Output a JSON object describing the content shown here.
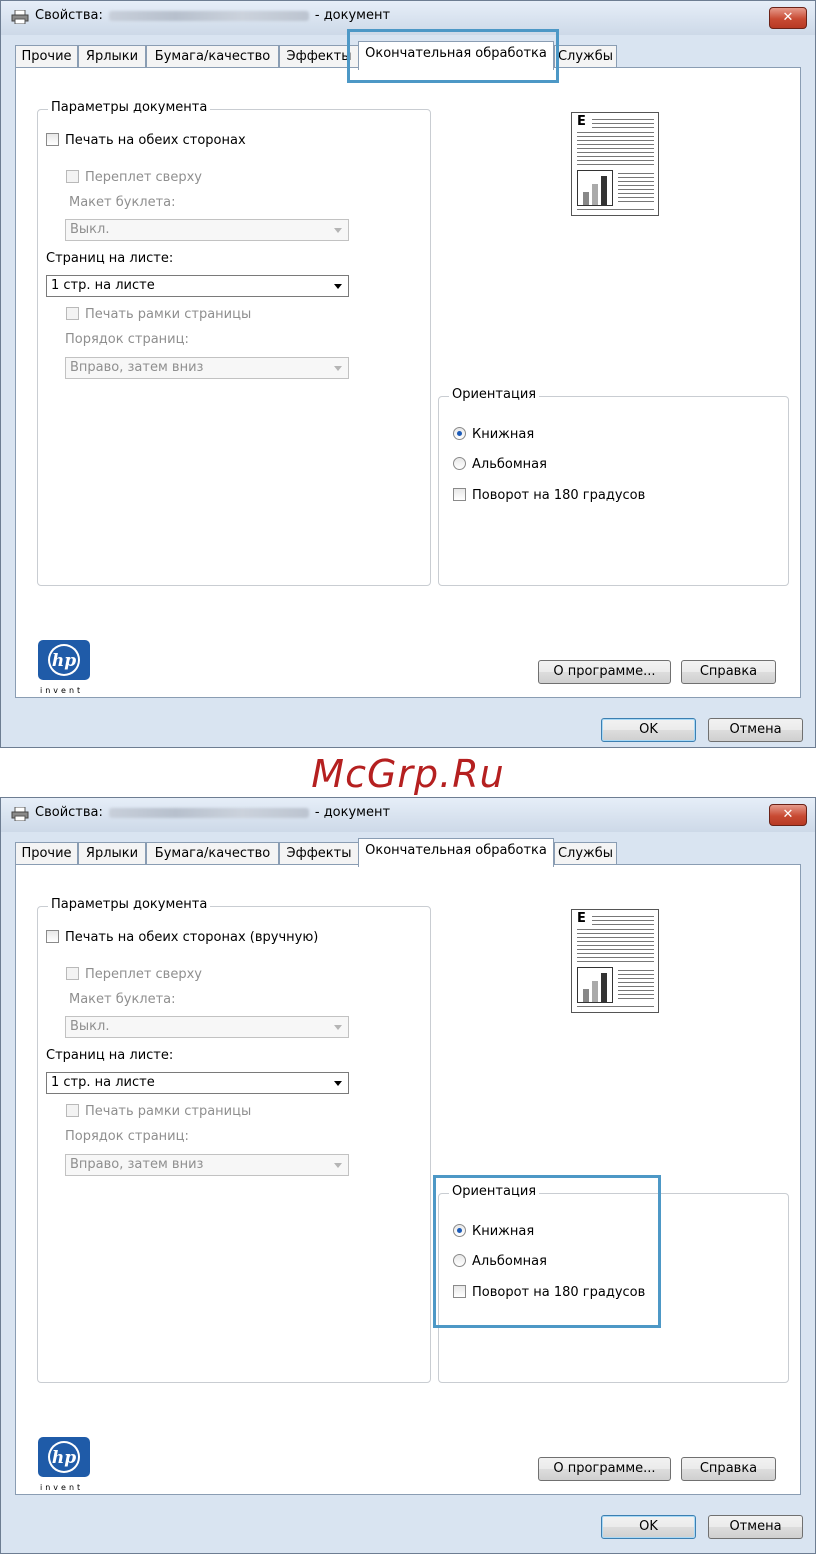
{
  "dialog": {
    "title_prefix": "Свойства:",
    "title_suffix": "- документ",
    "close_label": "✕",
    "tabs": [
      "Прочие",
      "Ярлыки",
      "Бумага/качество",
      "Эффекты",
      "Окончательная обработка",
      "Службы"
    ],
    "active_tab": "Окончательная обработка",
    "doc_options": {
      "legend": "Параметры документа",
      "duplex_top": "Печать на обеих сторонах",
      "duplex_bottom": "Печать на обеих сторонах (вручную)",
      "binding_top": "Переплет сверху",
      "booklet_label": "Макет буклета:",
      "booklet_value": "Выкл.",
      "pages_per_sheet_label": "Страниц на листе:",
      "pages_per_sheet_value": "1 стр. на листе",
      "print_borders": "Печать рамки страницы",
      "page_order_label": "Порядок страниц:",
      "page_order_value": "Вправо, затем вниз"
    },
    "orientation": {
      "legend": "Ориентация",
      "portrait": "Книжная",
      "landscape": "Альбомная",
      "rotate": "Поворот на 180 градусов",
      "selected": "Книжная"
    },
    "logo_text": "invent",
    "buttons": {
      "about": "О программе...",
      "help": "Справка",
      "ok": "OK",
      "cancel": "Отмена"
    },
    "colors": {
      "highlight": "#4d98c6",
      "close": "#c84a33"
    }
  },
  "watermark": "McGrp.Ru"
}
